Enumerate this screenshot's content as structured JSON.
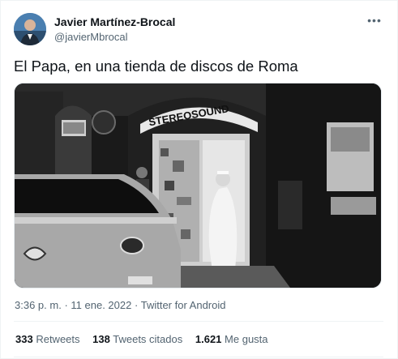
{
  "author": {
    "name": "Javier Martínez-Brocal",
    "handle": "@javierMbrocal"
  },
  "more_label": "•••",
  "tweet": {
    "text": "El Papa, en una tienda de discos de Roma",
    "photo_sign": "STEREOSOUND"
  },
  "meta": {
    "time": "3:36 p. m.",
    "separator": "·",
    "date": "11 ene. 2022",
    "source": "Twitter for Android"
  },
  "stats": {
    "retweets_count": "333",
    "retweets_label": "Retweets",
    "quotes_count": "138",
    "quotes_label": "Tweets citados",
    "likes_count": "1.621",
    "likes_label": "Me gusta"
  }
}
